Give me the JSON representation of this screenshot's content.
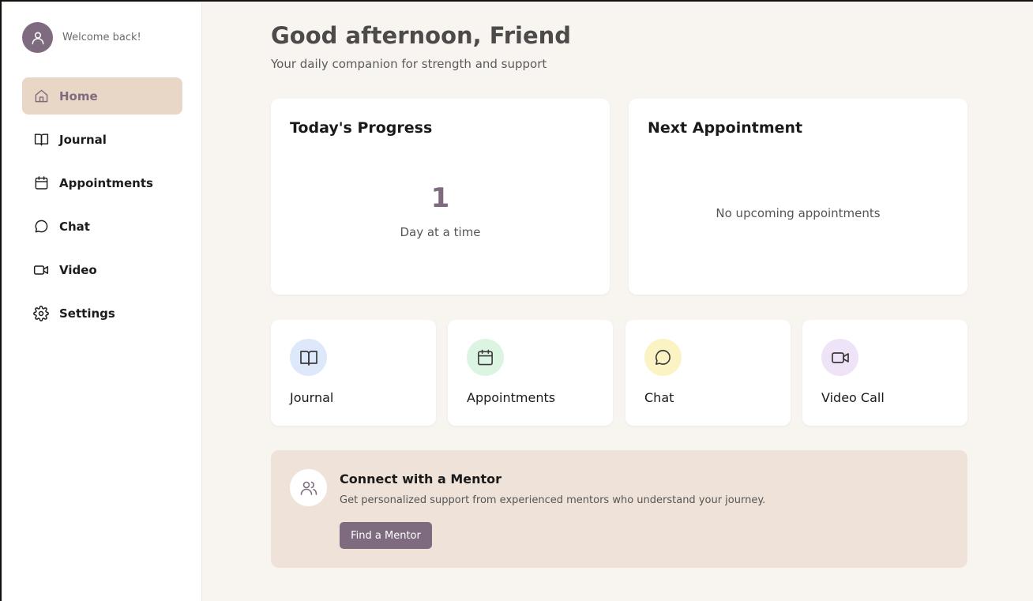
{
  "sidebar": {
    "welcome": "Welcome back!",
    "items": [
      {
        "label": "Home",
        "icon": "home-icon",
        "active": true
      },
      {
        "label": "Journal",
        "icon": "book-icon"
      },
      {
        "label": "Appointments",
        "icon": "calendar-icon"
      },
      {
        "label": "Chat",
        "icon": "chat-icon"
      },
      {
        "label": "Video",
        "icon": "video-icon"
      },
      {
        "label": "Settings",
        "icon": "gear-icon"
      }
    ]
  },
  "header": {
    "greeting": "Good afternoon, Friend",
    "subtitle": "Your daily companion for strength and support"
  },
  "progress": {
    "title": "Today's Progress",
    "value": "1",
    "label": "Day at a time"
  },
  "appointment": {
    "title": "Next Appointment",
    "empty": "No upcoming appointments"
  },
  "quick_actions": [
    {
      "label": "Journal",
      "icon": "book-icon",
      "color": "#dde8fb"
    },
    {
      "label": "Appointments",
      "icon": "calendar-icon",
      "color": "#dcf5e3"
    },
    {
      "label": "Chat",
      "icon": "chat-icon",
      "color": "#fbf3c4"
    },
    {
      "label": "Video Call",
      "icon": "video-icon",
      "color": "#efe3f7"
    }
  ],
  "mentor": {
    "title": "Connect with a Mentor",
    "description": "Get personalized support from experienced mentors who understand your journey.",
    "button": "Find a Mentor"
  },
  "colors": {
    "accent": "#7e6b7f",
    "active_nav_bg": "#e8d6c6",
    "page_bg": "#f8f5f1",
    "mentor_bg": "#efe3d9"
  }
}
